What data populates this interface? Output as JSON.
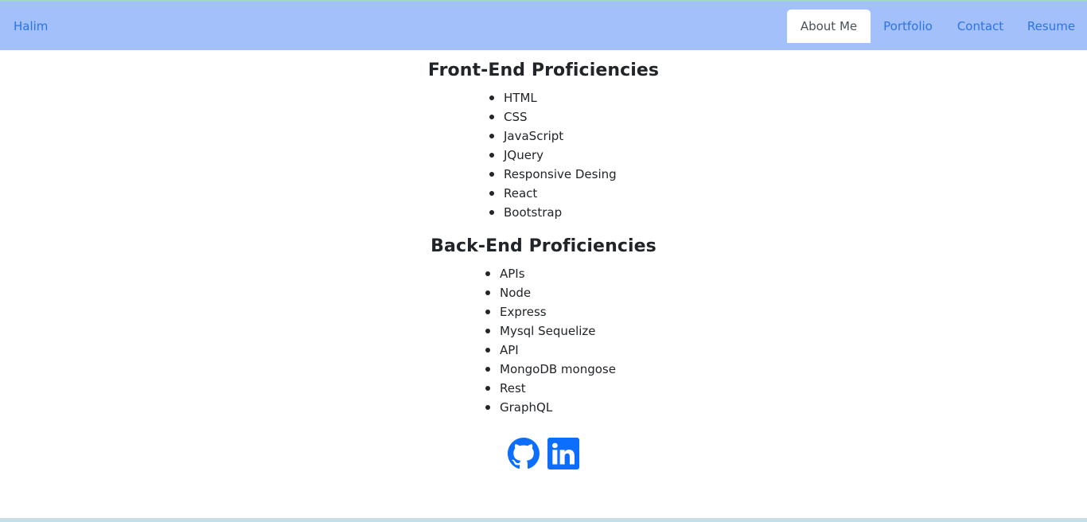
{
  "navbar": {
    "brand": "Halim",
    "tabs": [
      {
        "label": "About Me",
        "active": true
      },
      {
        "label": "Portfolio",
        "active": false
      },
      {
        "label": "Contact",
        "active": false
      },
      {
        "label": "Resume",
        "active": false
      }
    ]
  },
  "front_end": {
    "title": "Front-End Proficiencies",
    "items": [
      "HTML",
      "CSS",
      "JavaScript",
      "JQuery",
      "Responsive Desing",
      "React",
      "Bootstrap"
    ]
  },
  "back_end": {
    "title": "Back-End Proficiencies",
    "items": [
      "APIs",
      "Node",
      "Express",
      "Mysql Sequelize",
      "API",
      "MongoDB mongose",
      "Rest",
      "GraphQL"
    ]
  },
  "social": {
    "github_icon": "github-icon",
    "linkedin_icon": "linkedin-icon"
  },
  "colors": {
    "navbar_bg": "#a4c0fa",
    "link": "#2a74e6",
    "icon_blue": "#0d6efd"
  }
}
